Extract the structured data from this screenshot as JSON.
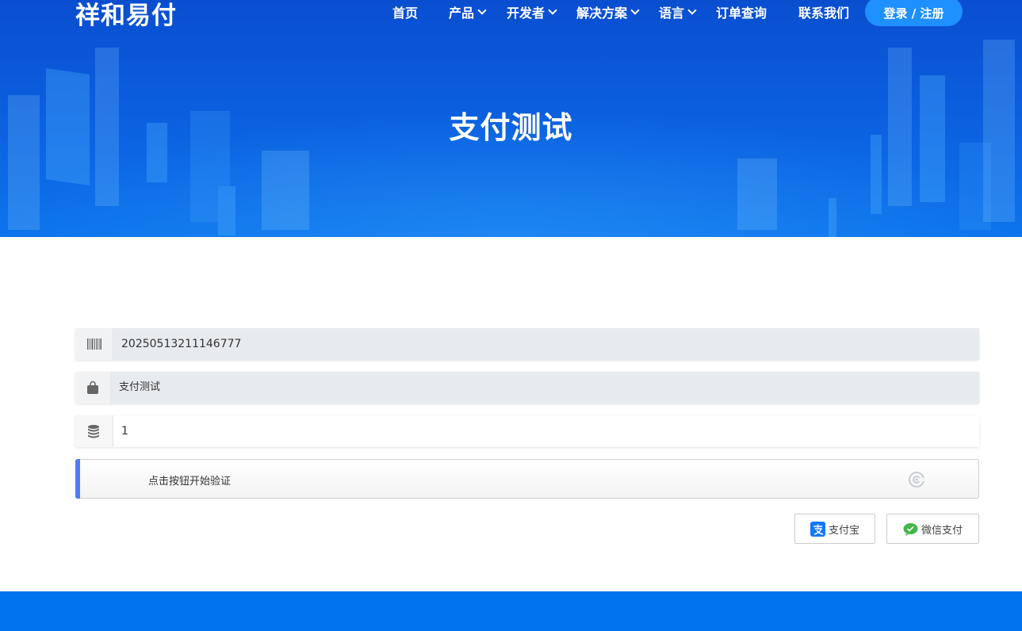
{
  "brand": {
    "logo_text": "祥和易付"
  },
  "nav": {
    "items": [
      {
        "label": "首页"
      },
      {
        "label": "产品"
      },
      {
        "label": "开发者"
      },
      {
        "label": "解决方案"
      },
      {
        "label": "语言"
      },
      {
        "label": "订单查询"
      },
      {
        "label": "联系我们"
      }
    ],
    "login_label": "登录 / 注册"
  },
  "hero": {
    "title": "支付测试"
  },
  "form": {
    "order_no": "20250513211146777",
    "product_name": "支付测试",
    "amount": "1"
  },
  "captcha": {
    "prompt": "点击按钮开始验证"
  },
  "payment": {
    "alipay_label": "支付宝",
    "wechat_label": "微信支付"
  },
  "colors": {
    "hero": "#0b5ede",
    "accent": "#1e90ff",
    "captcha_bar": "#4d7ef7",
    "footer": "#0073ee"
  }
}
